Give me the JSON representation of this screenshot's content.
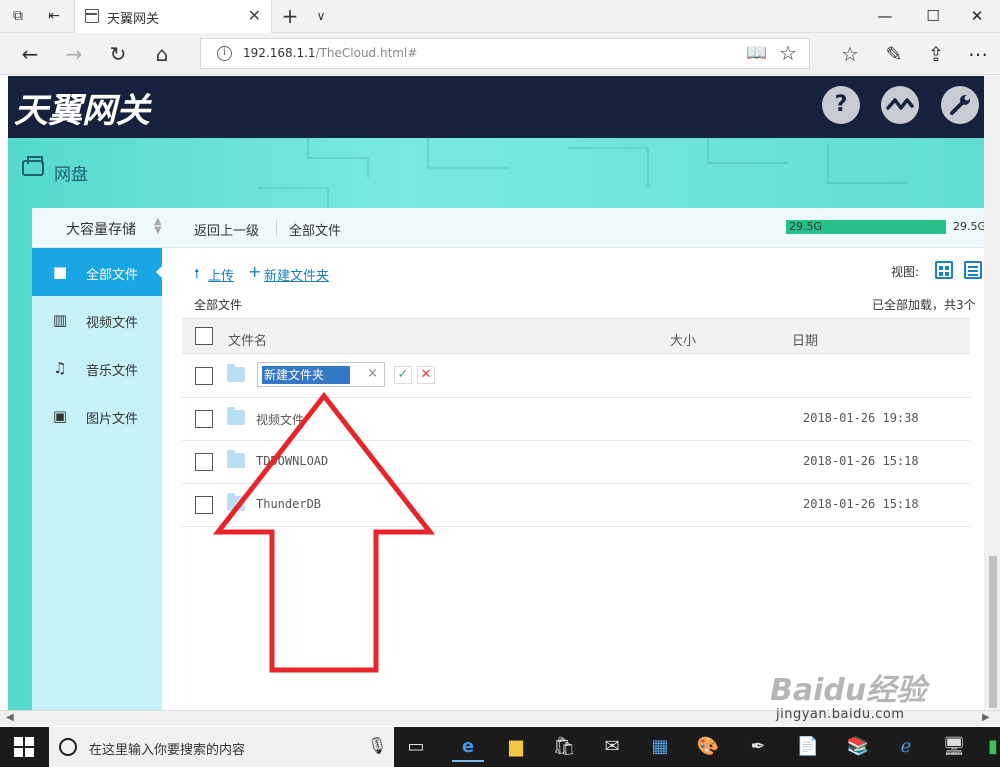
{
  "browser": {
    "tab_title": "天翼网关",
    "url_host": "192.168.1.1",
    "url_path": "/TheCloud.html#"
  },
  "header": {
    "logo_text": "天翼网关",
    "help_icon": "?",
    "status_icon": "wave-icon",
    "settings_icon": "wrench-icon"
  },
  "section": {
    "title": "网盘"
  },
  "topbar": {
    "storage_label": "大容量存储",
    "back_up": "返回上一级",
    "all_files": "全部文件",
    "quota_used": "29.5G",
    "quota_total": "29.5G",
    "quota_fraction": 1.0
  },
  "sidebar": {
    "items": [
      {
        "label": "全部文件",
        "icon": "briefcase-icon",
        "active": true
      },
      {
        "label": "视频文件",
        "icon": "film-icon",
        "active": false
      },
      {
        "label": "音乐文件",
        "icon": "music-note-icon",
        "active": false
      },
      {
        "label": "图片文件",
        "icon": "picture-icon",
        "active": false
      }
    ]
  },
  "toolbar": {
    "upload": "上传",
    "new_folder": "新建文件夹",
    "view_label": "视图:"
  },
  "content": {
    "crumb": "全部文件",
    "loaded_status": "已全部加载，共3个"
  },
  "table": {
    "headers": {
      "name": "文件名",
      "size": "大小",
      "date": "日期"
    },
    "rename_value": "新建文件夹",
    "rows": [
      {
        "name": "视频文件",
        "date": "2018-01-26 19:38"
      },
      {
        "name": "TDDOWNLOAD",
        "date": "2018-01-26 15:18"
      },
      {
        "name": "ThunderDB",
        "date": "2018-01-26 15:18"
      }
    ]
  },
  "taskbar": {
    "search_placeholder": "在这里输入你要搜索的内容"
  },
  "watermark": {
    "brand": "Baidu经验",
    "url": "jingyan.baidu.com"
  },
  "colors": {
    "header_bg": "#16213d",
    "accent_blue": "#1aa6e5",
    "quota_green": "#26c18a",
    "arrow_red": "#e8242a"
  }
}
